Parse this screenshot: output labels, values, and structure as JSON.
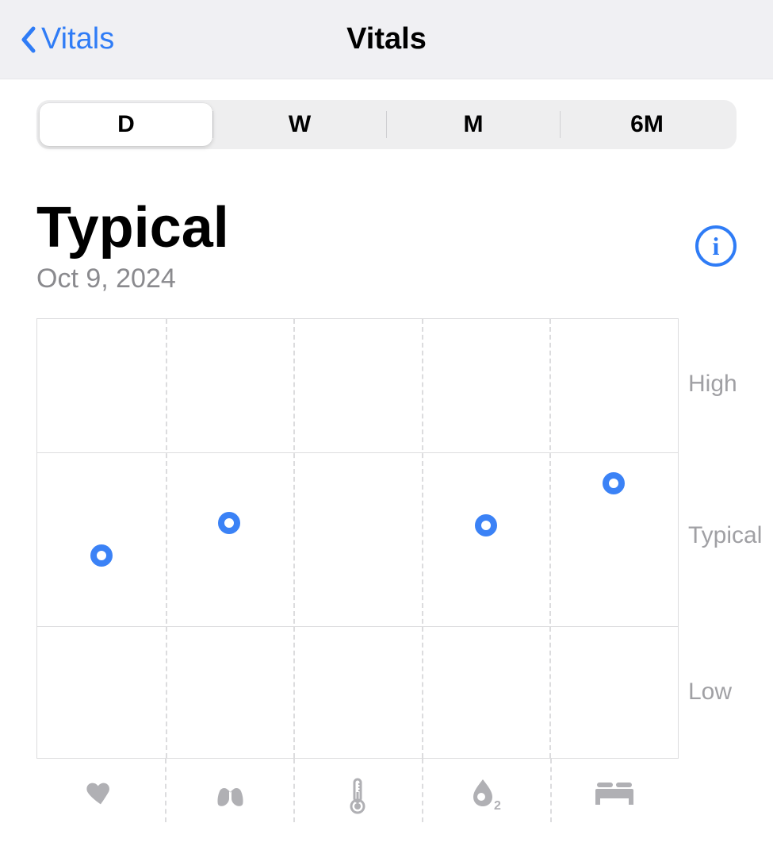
{
  "nav": {
    "back_label": "Vitals",
    "title": "Vitals"
  },
  "segmented": {
    "options": [
      "D",
      "W",
      "M",
      "6M"
    ],
    "selected_index": 0
  },
  "header": {
    "status": "Typical",
    "date": "Oct 9, 2024"
  },
  "chart_data": {
    "type": "scatter",
    "categories": [
      "heart-rate",
      "respiratory-rate",
      "wrist-temperature",
      "blood-oxygen",
      "sleep-duration"
    ],
    "y_levels": [
      "Low",
      "Typical",
      "High"
    ],
    "series": [
      {
        "name": "vitals",
        "values": [
          0.92,
          1.07,
          null,
          1.06,
          1.25
        ]
      }
    ],
    "ylim": [
      0,
      2
    ],
    "ylabel": "",
    "xlabel": ""
  },
  "y_axis_labels": {
    "high": "High",
    "typical": "Typical",
    "low": "Low"
  },
  "colors": {
    "accent": "#2f7cf6",
    "point": "#3b82f6",
    "muted": "#8a8a8e"
  }
}
